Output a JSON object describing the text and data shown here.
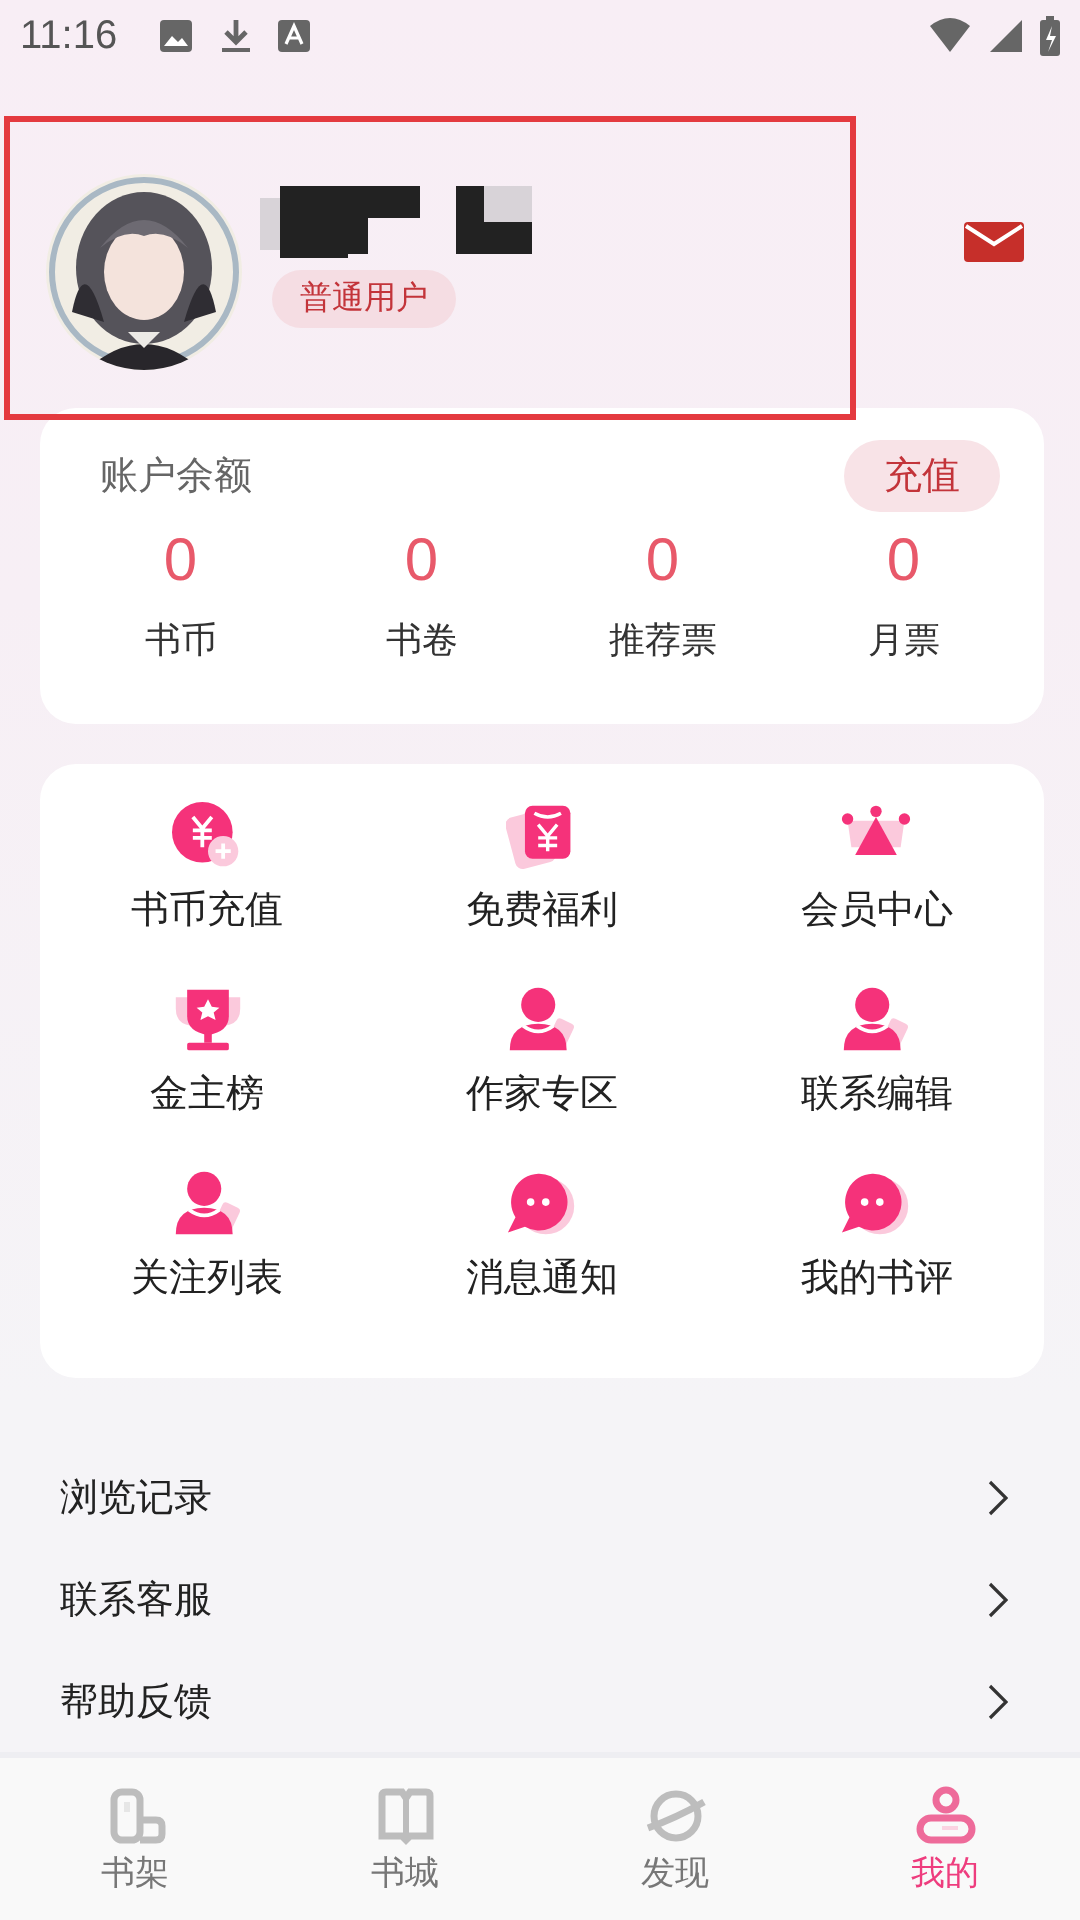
{
  "status_bar": {
    "time": "11:16"
  },
  "profile": {
    "badge": "普通用户",
    "highlighted": true
  },
  "balance": {
    "title": "账户余额",
    "action": "充值",
    "stats": [
      {
        "value": "0",
        "label": "书币"
      },
      {
        "value": "0",
        "label": "书卷"
      },
      {
        "value": "0",
        "label": "推荐票"
      },
      {
        "value": "0",
        "label": "月票"
      }
    ]
  },
  "features": [
    {
      "label": "书币充值",
      "kind": "coin"
    },
    {
      "label": "免费福利",
      "kind": "packet"
    },
    {
      "label": "会员中心",
      "kind": "crown"
    },
    {
      "label": "金主榜",
      "kind": "trophy"
    },
    {
      "label": "作家专区",
      "kind": "person"
    },
    {
      "label": "联系编辑",
      "kind": "person"
    },
    {
      "label": "关注列表",
      "kind": "person"
    },
    {
      "label": "消息通知",
      "kind": "chat"
    },
    {
      "label": "我的书评",
      "kind": "chat"
    }
  ],
  "menu": [
    {
      "label": "浏览记录"
    },
    {
      "label": "联系客服"
    },
    {
      "label": "帮助反馈"
    }
  ],
  "tabs": [
    {
      "label": "书架",
      "kind": "shelf",
      "selected": false
    },
    {
      "label": "书城",
      "kind": "book",
      "selected": false
    },
    {
      "label": "发现",
      "kind": "planet",
      "selected": false
    },
    {
      "label": "我的",
      "kind": "me",
      "selected": true
    }
  ]
}
